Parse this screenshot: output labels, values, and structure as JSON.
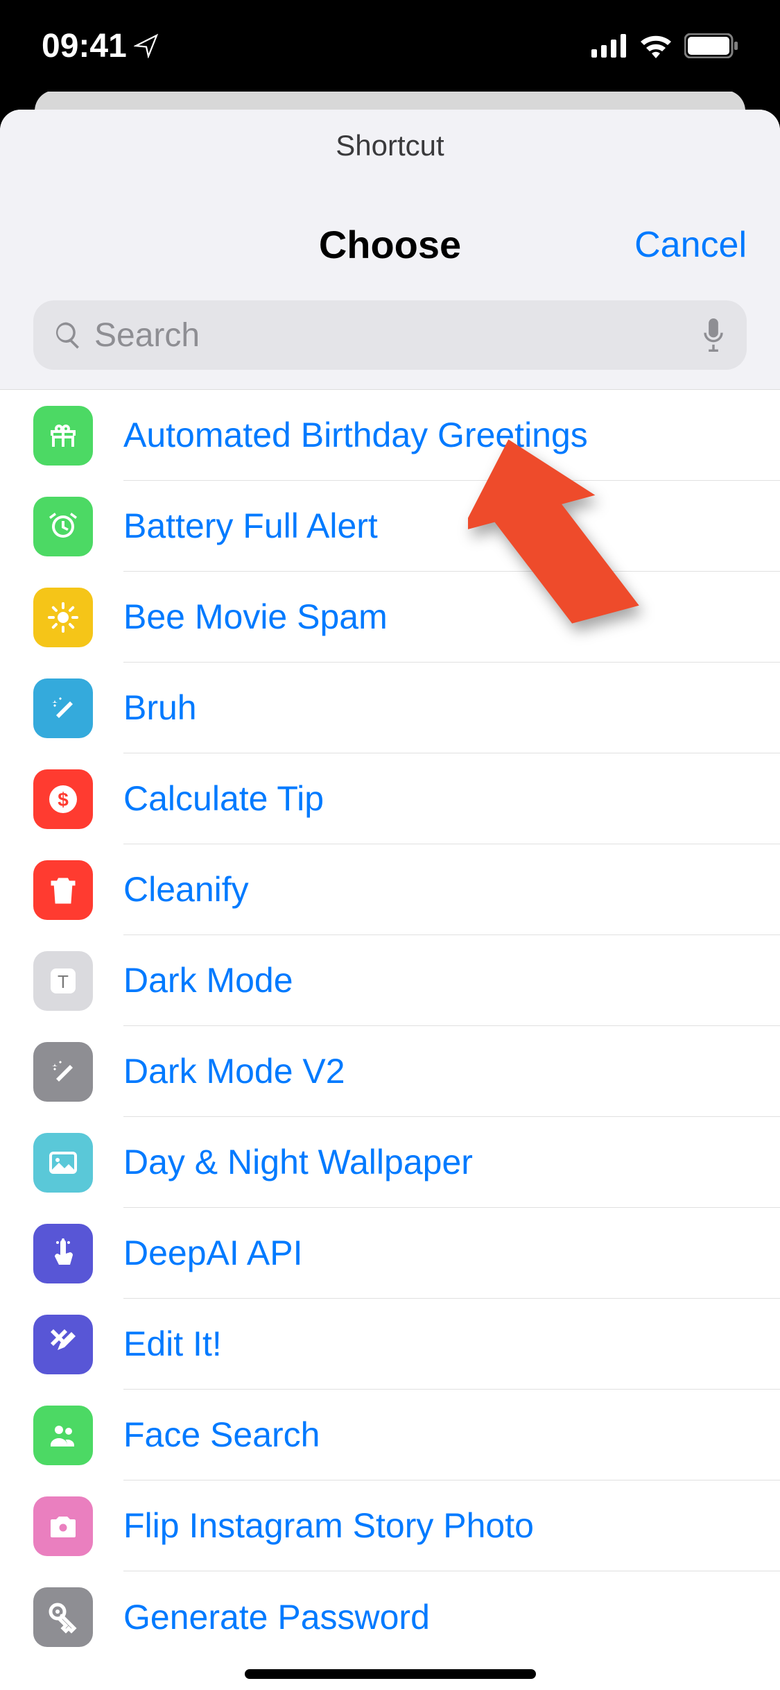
{
  "status": {
    "time": "09:41"
  },
  "sheet": {
    "mini_title": "Shortcut",
    "title": "Choose",
    "cancel": "Cancel"
  },
  "search": {
    "placeholder": "Search",
    "value": ""
  },
  "shortcuts": [
    {
      "label": "Automated Birthday Greetings",
      "icon": "gift",
      "bg": "#4CD964"
    },
    {
      "label": "Battery Full Alert",
      "icon": "alarm",
      "bg": "#4CD964"
    },
    {
      "label": "Bee Movie Spam",
      "icon": "sun",
      "bg": "#F5C518"
    },
    {
      "label": "Bruh",
      "icon": "wand",
      "bg": "#34AADC"
    },
    {
      "label": "Calculate Tip",
      "icon": "dollar",
      "bg": "#FF3B30"
    },
    {
      "label": "Cleanify",
      "icon": "trash",
      "bg": "#FF3B30"
    },
    {
      "label": "Dark Mode",
      "icon": "t-letter",
      "bg": "#DADADE"
    },
    {
      "label": "Dark Mode V2",
      "icon": "wand",
      "bg": "#8E8E93"
    },
    {
      "label": "Day & Night Wallpaper",
      "icon": "photo",
      "bg": "#5AC8D8"
    },
    {
      "label": "DeepAI API",
      "icon": "tap",
      "bg": "#5856D6"
    },
    {
      "label": "Edit It!",
      "icon": "tools",
      "bg": "#5856D6"
    },
    {
      "label": "Face Search",
      "icon": "people",
      "bg": "#4CD964"
    },
    {
      "label": "Flip Instagram Story Photo",
      "icon": "camera",
      "bg": "#EA7FBF"
    },
    {
      "label": "Generate Password",
      "icon": "key",
      "bg": "#8E8E93"
    }
  ]
}
